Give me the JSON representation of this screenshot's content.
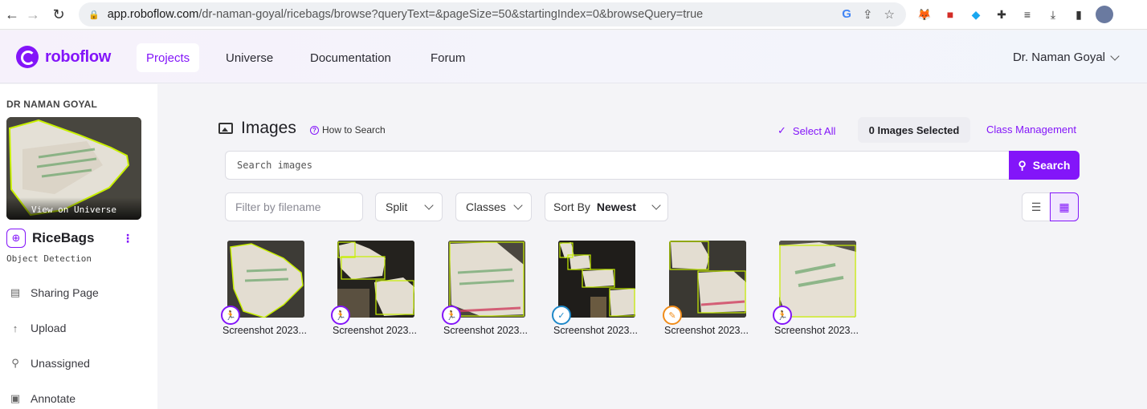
{
  "browser": {
    "url_host": "app.roboflow.com",
    "url_path": "/dr-naman-goyal/ricebags/browse?queryText=&pageSize=50&startingIndex=0&browseQuery=true"
  },
  "header": {
    "logo_text": "roboflow",
    "nav": [
      "Projects",
      "Universe",
      "Documentation",
      "Forum"
    ],
    "active_nav": "Projects",
    "user_name": "Dr. Naman Goyal"
  },
  "sidebar": {
    "workspace": "DR NAMAN GOYAL",
    "view_on_universe": "View on Universe",
    "project_name": "RiceBags",
    "project_type": "Object Detection",
    "items": [
      {
        "label": "Sharing Page",
        "icon": "document-icon"
      },
      {
        "label": "Upload",
        "icon": "upload-arrow-icon"
      },
      {
        "label": "Unassigned",
        "icon": "search-icon"
      },
      {
        "label": "Annotate",
        "icon": "annotate-icon"
      }
    ]
  },
  "main": {
    "title": "Images",
    "how_to_search": "How to Search",
    "select_all": "Select All",
    "selected_count": "0 Images Selected",
    "class_management": "Class Management",
    "search_placeholder": "Search images",
    "search_button": "Search",
    "filter_placeholder": "Filter by filename",
    "split_label": "Split",
    "classes_label": "Classes",
    "sort_by_label": "Sort By",
    "sort_by_value": "Newest"
  },
  "images": [
    {
      "label": "Screenshot 2023...",
      "badge": "annotate",
      "badge_color": "#8315f9"
    },
    {
      "label": "Screenshot 2023...",
      "badge": "annotate",
      "badge_color": "#8315f9"
    },
    {
      "label": "Screenshot 2023...",
      "badge": "annotate",
      "badge_color": "#8315f9"
    },
    {
      "label": "Screenshot 2023...",
      "badge": "approved",
      "badge_color": "#1e88c8"
    },
    {
      "label": "Screenshot 2023...",
      "badge": "edit",
      "badge_color": "#f08c1a"
    },
    {
      "label": "Screenshot 2023...",
      "badge": "annotate",
      "badge_color": "#8315f9"
    }
  ],
  "colors": {
    "accent": "#8315f9",
    "annotation": "#c8f000"
  }
}
